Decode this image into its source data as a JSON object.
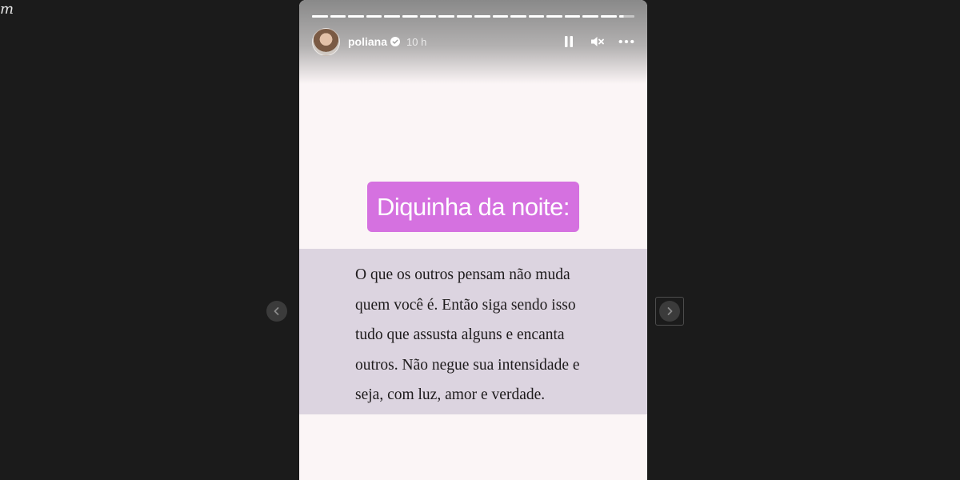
{
  "corner": {
    "glyph": "m"
  },
  "story": {
    "progress_segments": 18,
    "username": "poliana",
    "timestamp": "10 h",
    "verified": true,
    "headline": "Diquinha da noite:",
    "quote_lines": [
      "O que os outros pensam não muda",
      "quem você é. Então siga sendo isso",
      "tudo que assusta alguns e encanta",
      "outros. Não negue sua intensidade e",
      "seja, com luz, amor e verdade."
    ]
  },
  "icons": {
    "pause": "pause-icon",
    "mute": "mute-icon",
    "more": "more-options-icon",
    "prev": "chevron-left-icon",
    "next": "chevron-right-icon",
    "verified": "verified-badge-icon"
  },
  "colors": {
    "page_bg": "#1b1b1b",
    "story_bg": "#fbf5f6",
    "headline_bg": "#d571e0",
    "quote_band_bg": "#dcd4e0"
  }
}
